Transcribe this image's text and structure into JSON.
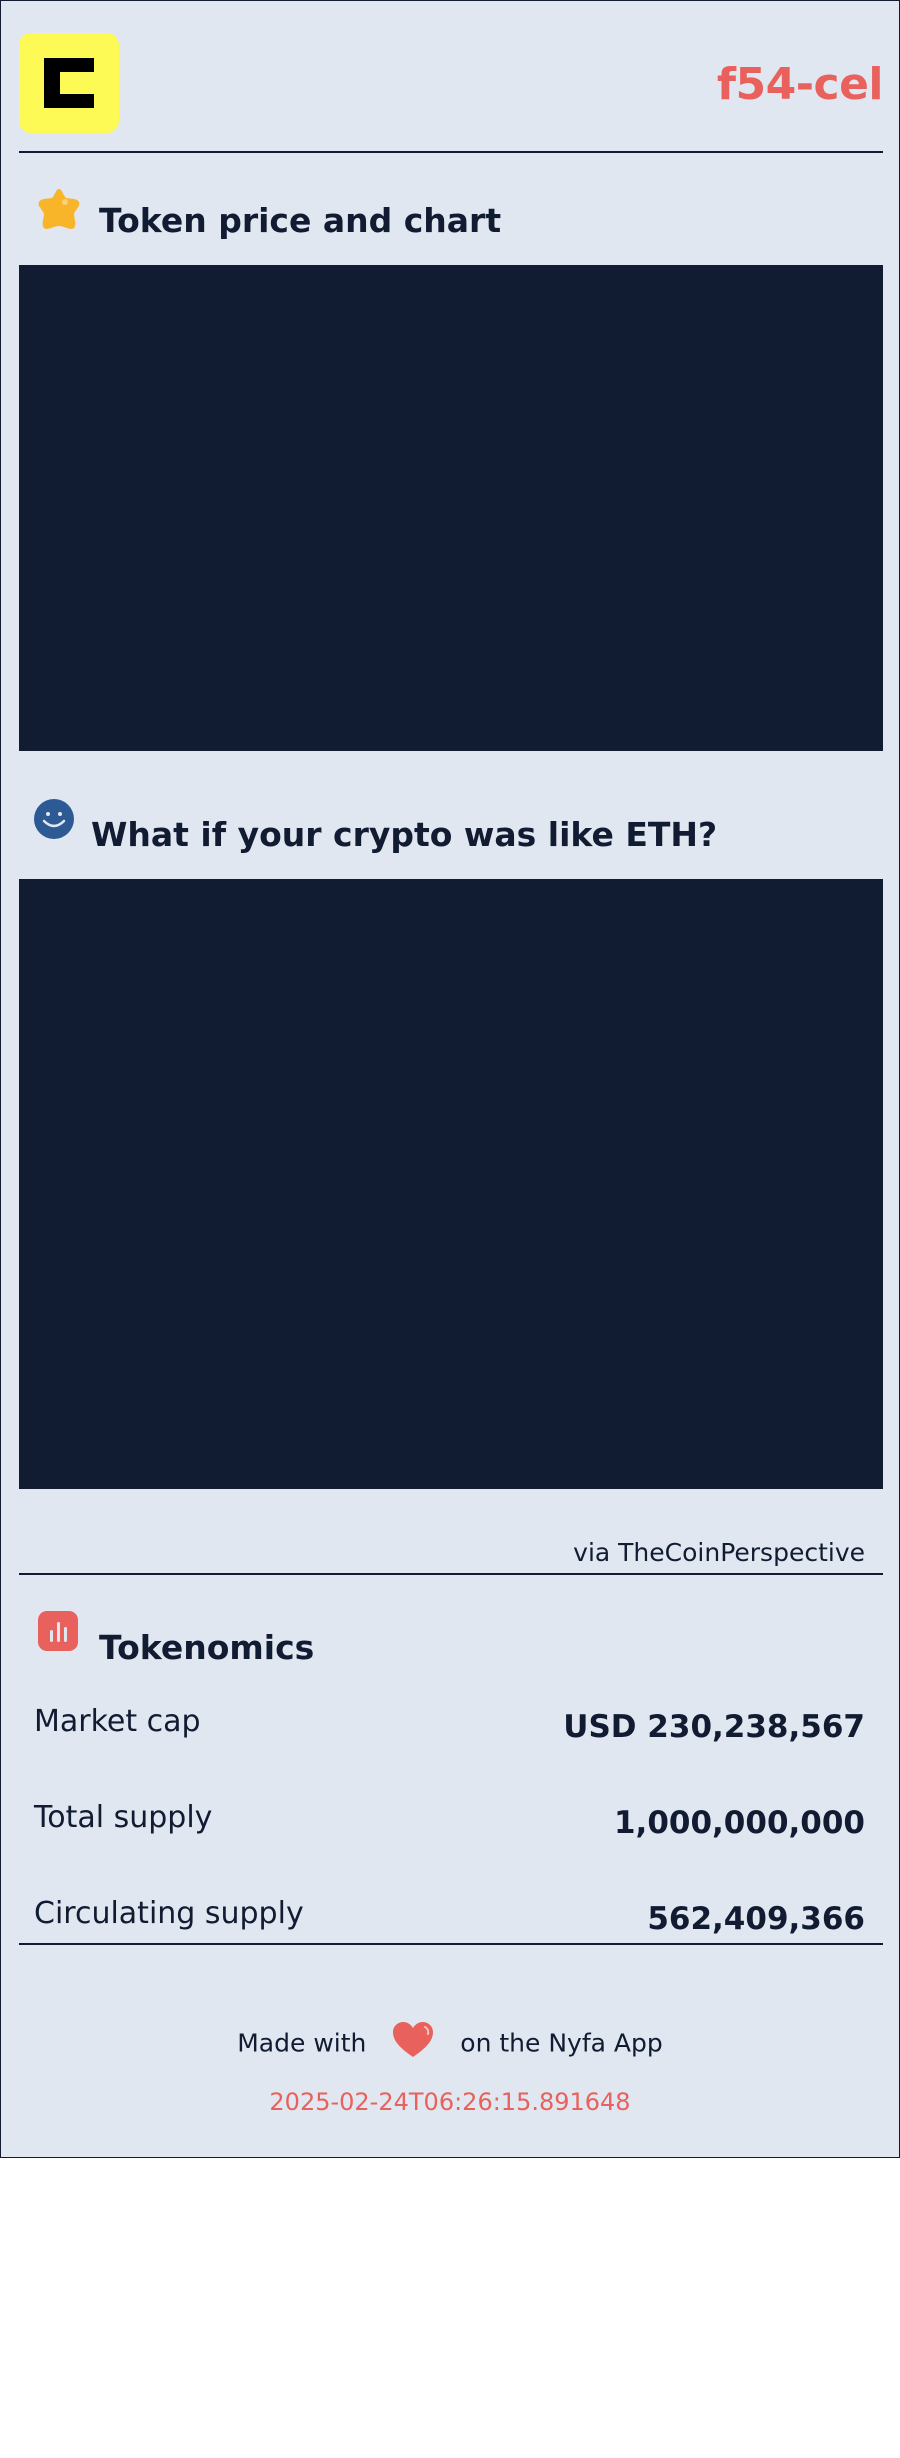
{
  "header": {
    "brand_code": "f54-cel"
  },
  "sections": {
    "price_chart": {
      "title": "Token price and chart",
      "icon": "star-icon"
    },
    "eth_compare": {
      "title": "What if your crypto was like ETH?",
      "icon": "smiley-icon",
      "source": "via TheCoinPerspective"
    },
    "tokenomics": {
      "title": "Tokenomics",
      "icon": "bar-chart-icon"
    }
  },
  "tokenomics": {
    "rows": [
      {
        "label": "Market cap",
        "value": "USD 230,238,567"
      },
      {
        "label": "Total supply",
        "value": "1,000,000,000"
      },
      {
        "label": "Circulating supply",
        "value": "562,409,366"
      }
    ]
  },
  "footer": {
    "made_with": "Made with",
    "on_app": "on the Nyfa App",
    "timestamp": "2025-02-24T06:26:15.891648"
  },
  "colors": {
    "background": "#e1e7f0",
    "navy": "#111c33",
    "accent": "#e8615c",
    "logo_yellow": "#fdfa55",
    "star": "#f8b52a",
    "smiley": "#2d5a94"
  }
}
